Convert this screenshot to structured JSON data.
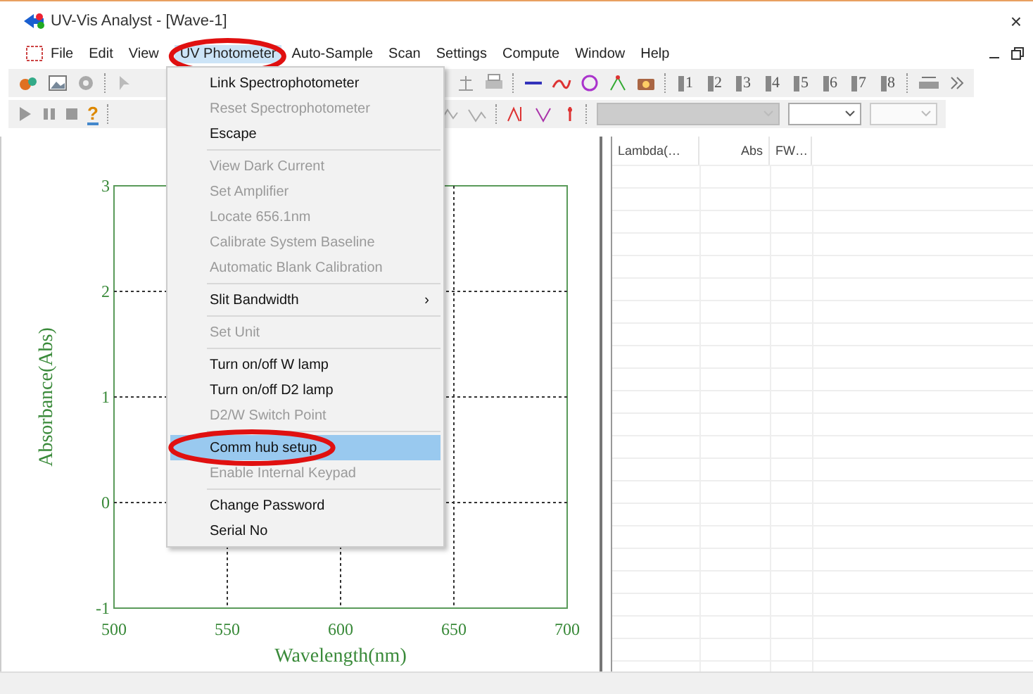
{
  "window": {
    "title": "UV-Vis Analyst - [Wave-1]",
    "close": "×"
  },
  "menubar": {
    "items": [
      {
        "label": "File",
        "selected": false,
        "circled": false
      },
      {
        "label": "Edit",
        "selected": false,
        "circled": false
      },
      {
        "label": "View",
        "selected": false,
        "circled": false
      },
      {
        "label": "UV Photometer",
        "selected": true,
        "circled": true
      },
      {
        "label": "Auto-Sample",
        "selected": false,
        "circled": false
      },
      {
        "label": "Scan",
        "selected": false,
        "circled": false
      },
      {
        "label": "Settings",
        "selected": false,
        "circled": false
      },
      {
        "label": "Compute",
        "selected": false,
        "circled": false
      },
      {
        "label": "Window",
        "selected": false,
        "circled": false
      },
      {
        "label": "Help",
        "selected": false,
        "circled": false
      }
    ]
  },
  "toolbar": {
    "trace_buttons": [
      "1",
      "2",
      "3",
      "4",
      "5",
      "6",
      "7",
      "8"
    ],
    "help_label": "?",
    "combos": [
      {
        "disabled": true
      },
      {
        "disabled": false
      },
      {
        "disabled": true
      }
    ]
  },
  "chart": {
    "chart_data": {
      "type": "line",
      "xlabel": "Wavelength(nm)",
      "ylabel": "Absorbance(Abs)",
      "xlim": [
        500,
        700
      ],
      "ylim": [
        -1,
        3
      ],
      "xticks": [
        500,
        550,
        600,
        650,
        700
      ],
      "yticks": [
        -1,
        0,
        1,
        2,
        3
      ],
      "grid": true
    }
  },
  "table": {
    "columns": [
      "Lambda(…",
      "Abs",
      "FW…"
    ]
  },
  "menu": {
    "items": [
      {
        "kind": "item",
        "label": "Link Spectrophotometer",
        "disabled": false,
        "selected": false,
        "circled": false
      },
      {
        "kind": "item",
        "label": "Reset Spectrophotometer",
        "disabled": true,
        "selected": false,
        "circled": false
      },
      {
        "kind": "item",
        "label": "Escape",
        "disabled": false,
        "selected": false,
        "circled": false
      },
      {
        "kind": "separator"
      },
      {
        "kind": "item",
        "label": "View Dark Current",
        "disabled": true,
        "selected": false,
        "circled": false
      },
      {
        "kind": "item",
        "label": "Set Amplifier",
        "disabled": true,
        "selected": false,
        "circled": false
      },
      {
        "kind": "item",
        "label": "Locate 656.1nm",
        "disabled": true,
        "selected": false,
        "circled": false
      },
      {
        "kind": "item",
        "label": "Calibrate System Baseline",
        "disabled": true,
        "selected": false,
        "circled": false
      },
      {
        "kind": "item",
        "label": "Automatic Blank Calibration",
        "disabled": true,
        "selected": false,
        "circled": false
      },
      {
        "kind": "separator"
      },
      {
        "kind": "item",
        "label": "Slit Bandwidth",
        "disabled": false,
        "selected": false,
        "circled": false,
        "arrow": "›"
      },
      {
        "kind": "separator"
      },
      {
        "kind": "item",
        "label": "Set Unit",
        "disabled": true,
        "selected": false,
        "circled": false
      },
      {
        "kind": "separator"
      },
      {
        "kind": "item",
        "label": "Turn on/off W lamp",
        "disabled": false,
        "selected": false,
        "circled": false
      },
      {
        "kind": "item",
        "label": "Turn on/off D2 lamp",
        "disabled": false,
        "selected": false,
        "circled": false
      },
      {
        "kind": "item",
        "label": "D2/W Switch Point",
        "disabled": true,
        "selected": false,
        "circled": false
      },
      {
        "kind": "separator"
      },
      {
        "kind": "item",
        "label": "Comm hub setup",
        "disabled": false,
        "selected": true,
        "circled": true
      },
      {
        "kind": "item",
        "label": "Enable Internal Keypad",
        "disabled": true,
        "selected": false,
        "circled": false
      },
      {
        "kind": "separator"
      },
      {
        "kind": "item",
        "label": "Change Password",
        "disabled": false,
        "selected": false,
        "circled": false
      },
      {
        "kind": "item",
        "label": "Serial No",
        "disabled": false,
        "selected": false,
        "circled": false
      }
    ]
  }
}
